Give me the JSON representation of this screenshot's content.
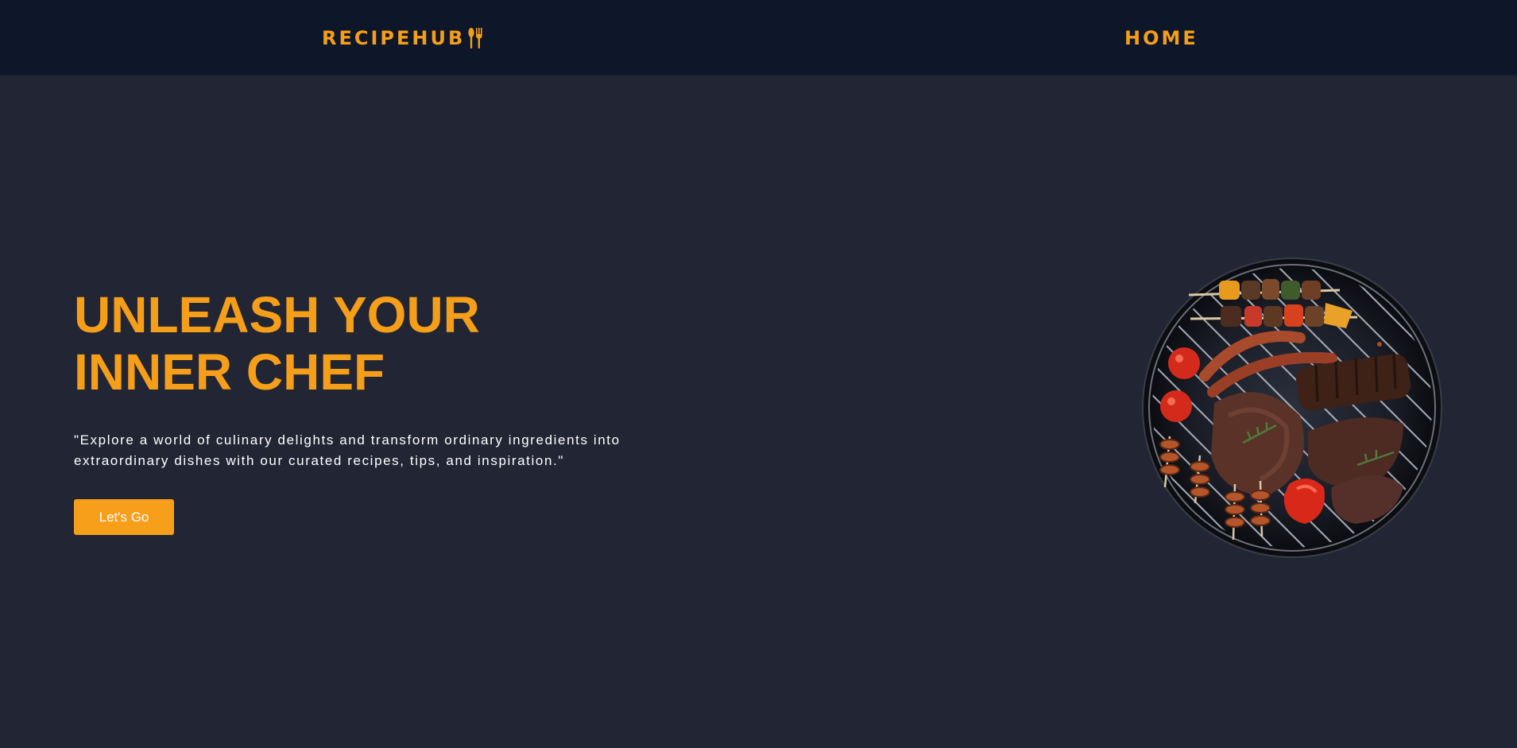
{
  "nav": {
    "brand": "RECIPEHUB",
    "brand_icon": "fork-spoon-icon",
    "home_label": "HOME"
  },
  "hero": {
    "title_line1": "UNLEASH YOUR",
    "title_line2": "INNER CHEF",
    "subtitle_line1": "\"Explore a world of culinary delights and transform ordinary ingredients into",
    "subtitle_line2": "extraordinary dishes with our curated recipes, tips, and inspiration.\"",
    "cta_label": "Let's Go",
    "image": "bbq-grill-image"
  },
  "colors": {
    "accent": "#f59e19",
    "background": "#222534",
    "navbar": "#0e1629",
    "text": "#ffffff"
  }
}
